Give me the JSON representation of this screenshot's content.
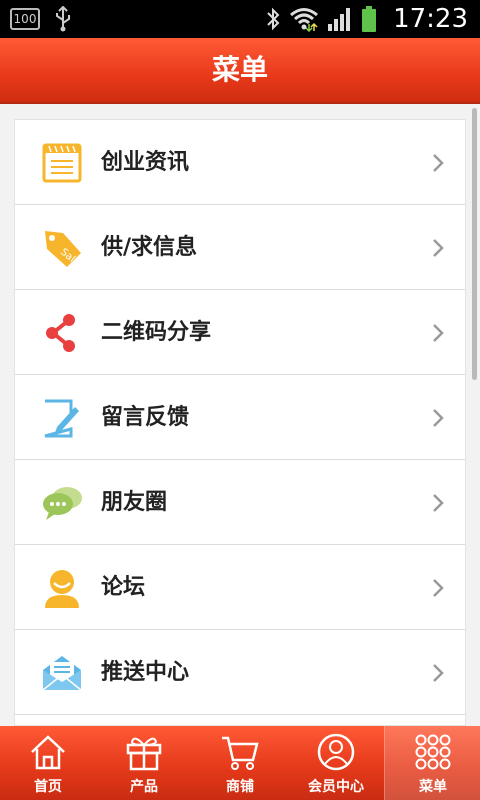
{
  "status_bar": {
    "battery_box_text": "100",
    "time": "17:23"
  },
  "header": {
    "title": "菜单"
  },
  "menu": {
    "items": [
      {
        "label": "创业资讯",
        "icon": "notepad-icon"
      },
      {
        "label": "供/求信息",
        "icon": "sale-tag-icon"
      },
      {
        "label": "二维码分享",
        "icon": "share-icon"
      },
      {
        "label": "留言反馈",
        "icon": "edit-note-icon"
      },
      {
        "label": "朋友圈",
        "icon": "chat-bubbles-icon"
      },
      {
        "label": "论坛",
        "icon": "user-avatar-icon"
      },
      {
        "label": "推送中心",
        "icon": "envelope-icon"
      }
    ]
  },
  "bottom_nav": {
    "items": [
      {
        "label": "首页",
        "icon": "home-icon"
      },
      {
        "label": "产品",
        "icon": "gift-icon"
      },
      {
        "label": "商铺",
        "icon": "cart-icon"
      },
      {
        "label": "会员中心",
        "icon": "member-icon"
      },
      {
        "label": "菜单",
        "icon": "grid-dots-icon"
      }
    ],
    "active_index": 4
  },
  "colors": {
    "accent": "#e8391a",
    "icon_orange": "#f7b52c",
    "icon_red": "#e8403f",
    "icon_blue": "#5bb6e6",
    "icon_green": "#9cc65a"
  }
}
